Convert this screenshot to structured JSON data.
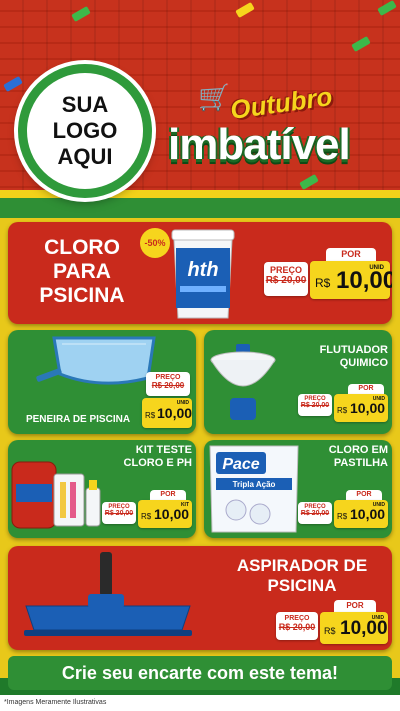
{
  "header": {
    "logo_line1": "SUA",
    "logo_line2": "LOGO",
    "logo_line3": "AQUI",
    "promo_top": "Outubro",
    "promo_bottom": "imbatível"
  },
  "products": [
    {
      "title_lines": [
        "CLORO",
        "PARA",
        "PSICINA"
      ],
      "badge": "-50%",
      "brand": "hth",
      "price_label": "PREÇO",
      "old_price": "R$ 20,00",
      "por_label": "POR",
      "currency": "R$",
      "new_price": "10,00",
      "unit": "UNID"
    },
    {
      "title": "PENEIRA DE PISCINA",
      "price_label": "PREÇO",
      "old_price": "R$ 20,00",
      "currency": "R$",
      "new_price": "10,00",
      "unit": "UNID"
    },
    {
      "title_lines": [
        "FLUTUADOR",
        "QUIMICO"
      ],
      "por_label": "POR",
      "price_label": "PREÇO",
      "old_price": "R$ 20,00",
      "currency": "R$",
      "new_price": "10,00",
      "unit": "UNID"
    },
    {
      "title_lines": [
        "KIT TESTE",
        "CLORO E PH"
      ],
      "por_label": "POR",
      "price_label": "PREÇO",
      "old_price": "R$ 20,00",
      "currency": "R$",
      "new_price": "10,00",
      "unit": "KIT"
    },
    {
      "title_lines": [
        "CLORO EM",
        "PASTILHA"
      ],
      "brand": "Pace",
      "brand_sub": "Tripla Ação",
      "por_label": "POR",
      "price_label": "PREÇO",
      "old_price": "R$ 20,00",
      "currency": "R$",
      "new_price": "10,00",
      "unit": "UNID"
    },
    {
      "title_lines": [
        "ASPIRADOR DE",
        "PSICINA"
      ],
      "por_label": "POR",
      "price_label": "PREÇO",
      "old_price": "R$ 20,00",
      "currency": "R$",
      "new_price": "10,00",
      "unit": "UNID"
    }
  ],
  "footer": {
    "banner": "Crie seu encarte com este tema!",
    "note": "*Imagens Meramente Ilustrativas"
  },
  "colors": {
    "red": "#c92a1c",
    "green": "#2f8f35",
    "yellow": "#f6d51d"
  }
}
